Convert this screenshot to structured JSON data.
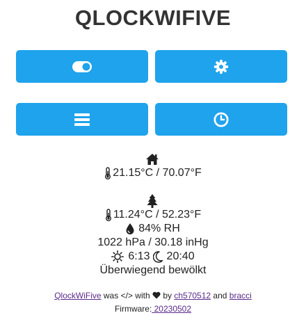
{
  "header": {
    "title": "QLOCKWIFIVE"
  },
  "buttons": [
    {
      "icon": "toggle-icon"
    },
    {
      "icon": "gear-icon"
    },
    {
      "icon": "menu-icon"
    },
    {
      "icon": "clock-icon"
    }
  ],
  "indoor": {
    "icon": "home-icon",
    "temperature": "21.15°C / 70.07°F"
  },
  "outdoor": {
    "icon": "tree-icon",
    "temperature": "11.24°C / 52.23°F",
    "humidity": "84% RH",
    "pressure": "1022 hPa / 30.18 inHg",
    "sunrise": "6:13",
    "sunset": "20:40",
    "condition": "Überwiegend bewölkt"
  },
  "footer": {
    "project_link": "QlockWiFive",
    "was_text": "was",
    "code_symbol": "</>",
    "with_text": "with",
    "by_text": "by",
    "author1": "ch570512",
    "and_text": "and",
    "author2": "bracci",
    "firmware_label": "Firmware:",
    "firmware_version": " 20230502"
  },
  "colors": {
    "accent": "#1fa3ec",
    "link": "#5a2a8a",
    "title": "#333333"
  }
}
